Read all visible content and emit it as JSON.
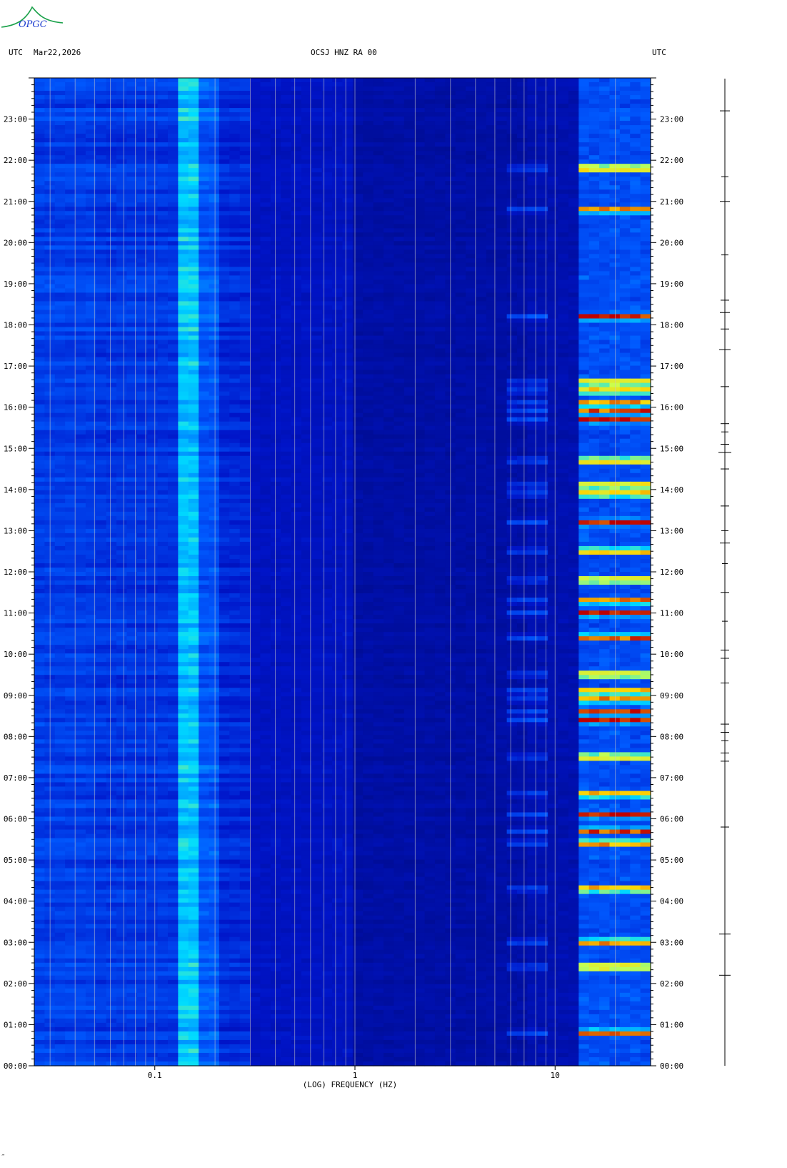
{
  "logo": {
    "text": "OPGC"
  },
  "header": {
    "left_tz": "UTC",
    "date": "Mar22,2026",
    "station": "OCSJ HNZ RA 00",
    "right_tz": "UTC"
  },
  "footer_mark": "‴",
  "chart_data": {
    "type": "heatmap",
    "title": "OCSJ HNZ RA 00",
    "xlabel": "(LOG) FREQUENCY (HZ)",
    "ylabel": "",
    "x_scale": "log",
    "xlim": [
      0.025,
      30
    ],
    "x_ticks": [
      {
        "value": 0.1,
        "label": "0.1"
      },
      {
        "value": 1,
        "label": "1"
      },
      {
        "value": 10,
        "label": "10"
      }
    ],
    "ylim_hours": [
      0,
      24
    ],
    "y_ticks": [
      {
        "value": 0,
        "label": "00:00"
      },
      {
        "value": 1,
        "label": "01:00"
      },
      {
        "value": 2,
        "label": "02:00"
      },
      {
        "value": 3,
        "label": "03:00"
      },
      {
        "value": 4,
        "label": "04:00"
      },
      {
        "value": 5,
        "label": "05:00"
      },
      {
        "value": 6,
        "label": "06:00"
      },
      {
        "value": 7,
        "label": "07:00"
      },
      {
        "value": 8,
        "label": "08:00"
      },
      {
        "value": 9,
        "label": "09:00"
      },
      {
        "value": 10,
        "label": "10:00"
      },
      {
        "value": 11,
        "label": "11:00"
      },
      {
        "value": 12,
        "label": "12:00"
      },
      {
        "value": 13,
        "label": "13:00"
      },
      {
        "value": 14,
        "label": "14:00"
      },
      {
        "value": 15,
        "label": "15:00"
      },
      {
        "value": 16,
        "label": "16:00"
      },
      {
        "value": 17,
        "label": "17:00"
      },
      {
        "value": 18,
        "label": "18:00"
      },
      {
        "value": 19,
        "label": "19:00"
      },
      {
        "value": 20,
        "label": "20:00"
      },
      {
        "value": 21,
        "label": "21:00"
      },
      {
        "value": 22,
        "label": "22:00"
      },
      {
        "value": 23,
        "label": "23:00"
      }
    ],
    "microseism_band_hz": [
      0.125,
      0.17
    ],
    "noisy_band_hz": [
      13,
      30
    ],
    "strong_events_hours": [
      2.2,
      3.2,
      5.8,
      7.4,
      7.6,
      7.9,
      8.1,
      8.3,
      9.3,
      9.9,
      10.1,
      10.8,
      11.5,
      12.2,
      12.7,
      13.0,
      13.6,
      14.5,
      14.9,
      15.1,
      15.4,
      15.6,
      16.5,
      17.4,
      17.9,
      18.3,
      18.6,
      19.7,
      21.0,
      21.6,
      23.2
    ],
    "colors": {
      "low": "#0010a0",
      "mid": "#00d8ff",
      "high": "#ffff40",
      "max": "#c00000"
    },
    "grid": true
  }
}
